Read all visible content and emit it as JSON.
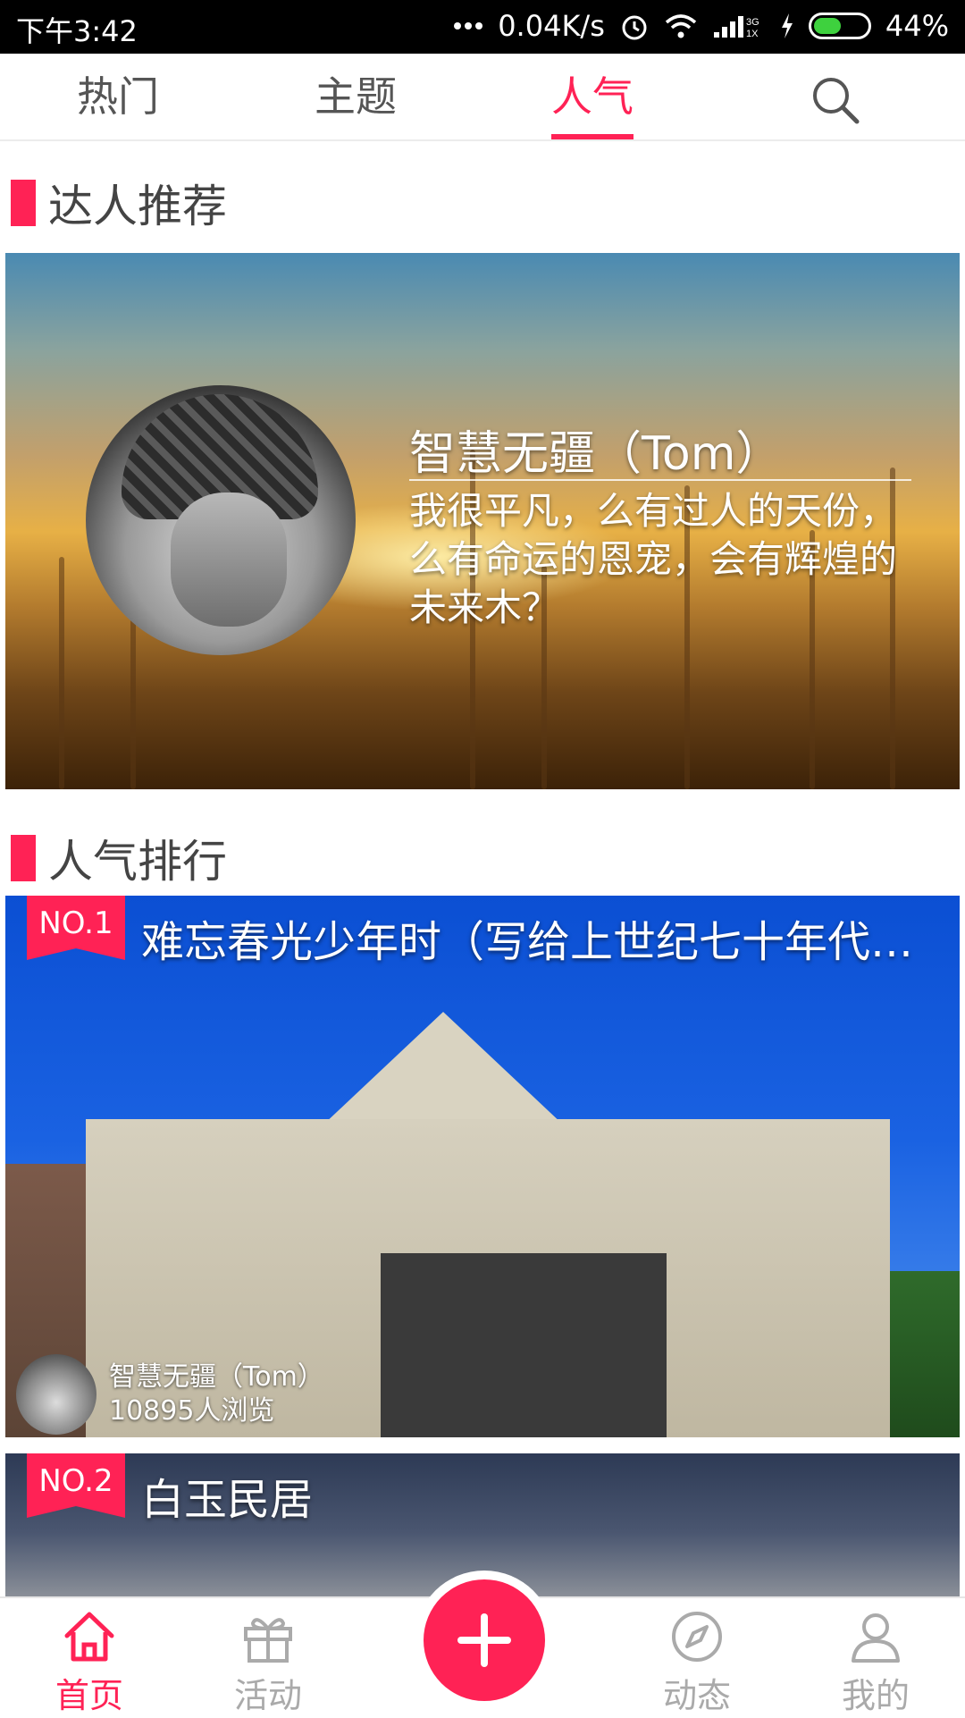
{
  "status_bar": {
    "time": "下午3:42",
    "network_speed": "0.04K/s",
    "network_type": "3G 1X",
    "battery": "44%",
    "icons": [
      "more-dots-icon",
      "alarm-icon",
      "wifi-icon",
      "signal-icon",
      "charging-icon",
      "battery-icon"
    ]
  },
  "tabs": [
    {
      "label": "热门",
      "active": false
    },
    {
      "label": "主题",
      "active": false
    },
    {
      "label": "人气",
      "active": true
    }
  ],
  "search_icon": "search-icon",
  "sections": {
    "expert": "达人推荐",
    "ranking": "人气排行"
  },
  "expert": {
    "name": "智慧无疆（Tom）",
    "bio": "我很平凡，么有过人的天份，么有命运的恩宠，会有辉煌的未来木？"
  },
  "ranking": [
    {
      "badge": "NO.1",
      "title": "难忘春光少年时（写给上世纪七十年代…",
      "author": "智慧无疆（Tom）",
      "views": "10895人浏览"
    },
    {
      "badge": "NO.2",
      "title": "白玉民居"
    }
  ],
  "bottom_nav": [
    {
      "label": "首页",
      "icon": "home-icon",
      "active": true
    },
    {
      "label": "活动",
      "icon": "gift-icon",
      "active": false
    },
    {
      "label": "动态",
      "icon": "compass-icon",
      "active": false
    },
    {
      "label": "我的",
      "icon": "user-icon",
      "active": false
    }
  ],
  "fab_icon": "plus-icon",
  "colors": {
    "accent": "#ff2255",
    "inactive": "#aaaaaa",
    "tab_text": "#555555"
  }
}
